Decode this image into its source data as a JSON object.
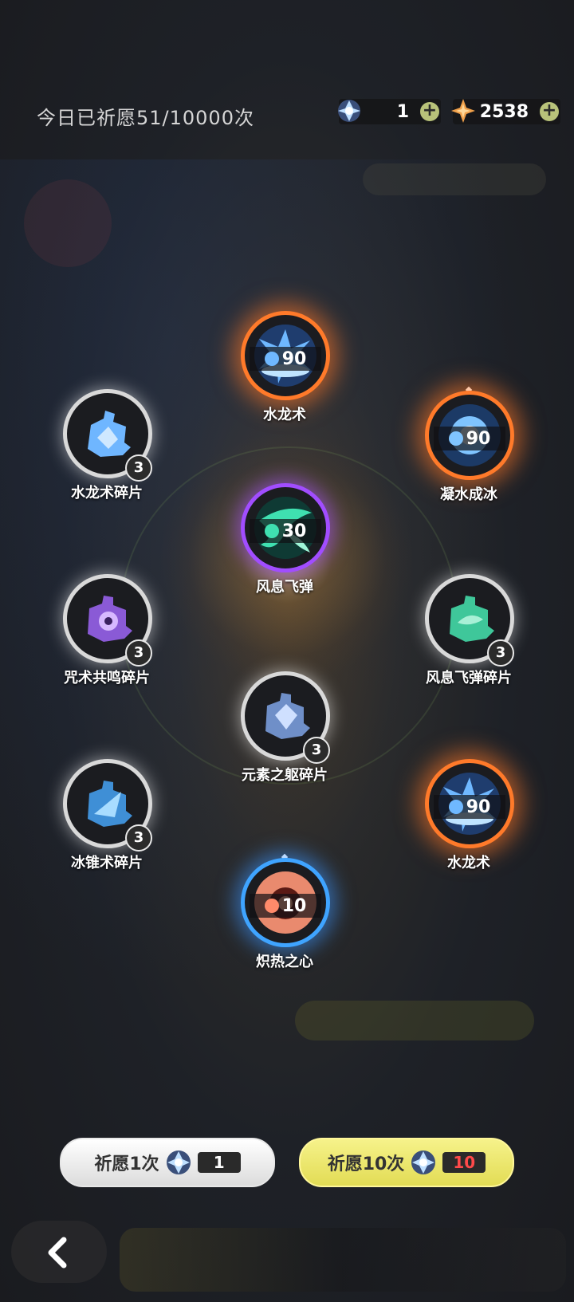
{
  "header": {
    "wish_count_text": "今日已祈愿51/10000次",
    "currency": [
      {
        "icon": "blue-crystal-icon",
        "value": "1"
      },
      {
        "icon": "gold-star-gem-icon",
        "value": "2538"
      }
    ],
    "plus_symbol": "+"
  },
  "items": [
    {
      "name": "水龙术",
      "rarity": "orange",
      "level": "90",
      "color": "#4aa8ff"
    },
    {
      "name": "水龙术碎片",
      "rarity": "white",
      "count": "3",
      "color": "#6fb6ff"
    },
    {
      "name": "凝水成冰",
      "rarity": "orange",
      "level": "90",
      "color": "#7fc4ff"
    },
    {
      "name": "风息飞弹",
      "rarity": "purple",
      "level": "30",
      "color": "#3fe0b0"
    },
    {
      "name": "咒术共鸣碎片",
      "rarity": "white",
      "count": "3",
      "color": "#b57cff"
    },
    {
      "name": "风息飞弹碎片",
      "rarity": "white",
      "count": "3",
      "color": "#5fe0b5"
    },
    {
      "name": "元素之躯碎片",
      "rarity": "white",
      "count": "3",
      "color": "#9fbfff"
    },
    {
      "name": "冰锥术碎片",
      "rarity": "white",
      "count": "3",
      "color": "#66c2ff"
    },
    {
      "name": "水龙术",
      "rarity": "orange",
      "level": "90",
      "color": "#4aa8ff"
    },
    {
      "name": "炽热之心",
      "rarity": "blue",
      "level": "10",
      "color": "#ff8a6a"
    }
  ],
  "buttons": {
    "wish_once": {
      "label": "祈愿1次",
      "cost": "1"
    },
    "wish_ten": {
      "label": "祈愿10次",
      "cost": "10"
    }
  },
  "colors": {
    "orange": "#ff7a2a",
    "purple": "#a14dff",
    "blue": "#3fa4ff",
    "white": "#d9d9d9",
    "ten_button": "#f6f28a",
    "cost_red": "#ff4a4a"
  }
}
